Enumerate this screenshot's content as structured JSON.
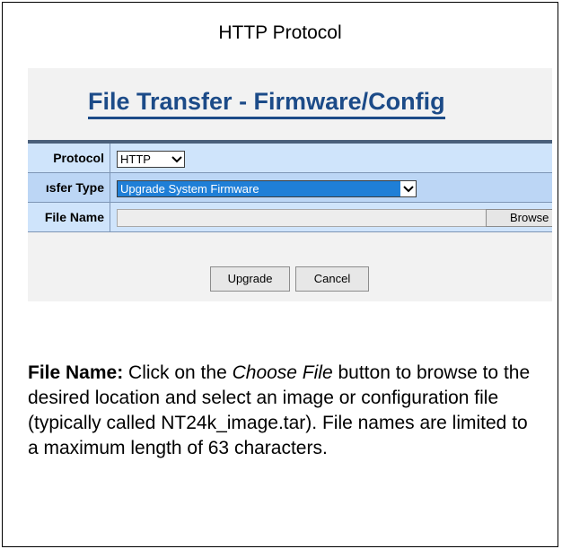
{
  "caption": "HTTP Protocol",
  "panel": {
    "title": "File Transfer - Firmware/Config",
    "rows": [
      {
        "label": "Protocol",
        "value": "HTTP"
      },
      {
        "label": "ısfer Type",
        "value": "Upgrade System Firmware"
      },
      {
        "label": "File Name",
        "value": ""
      }
    ],
    "browse_label": "Browse",
    "upgrade_label": "Upgrade",
    "cancel_label": "Cancel"
  },
  "description": {
    "lead": "File Name:",
    "part1": " Click on the ",
    "emph": "Choose File",
    "part2": " button to browse to the desired location and select an image or configuration file (typically called NT24k_image.tar). File names are limited to a maximum length of 63 characters."
  },
  "colors": {
    "title": "#1c4b88",
    "row_light": "#cfe4fb",
    "row_dark": "#bcd6f5",
    "selected": "#1f7fd7"
  }
}
